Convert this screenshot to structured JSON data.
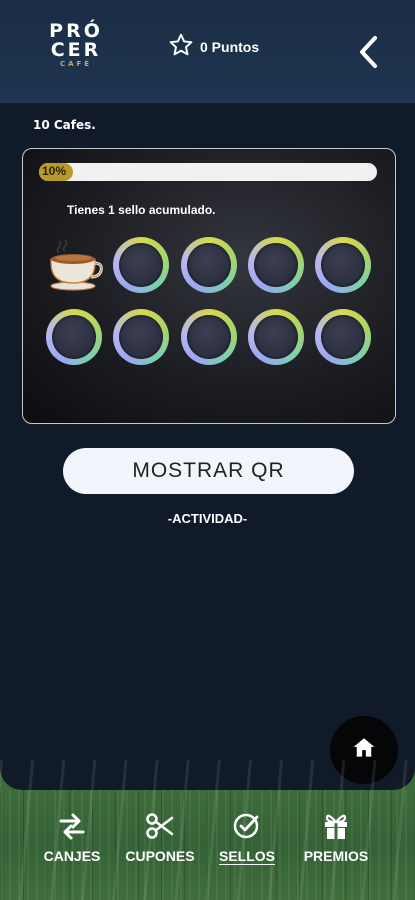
{
  "header": {
    "logo_line1": "PRÓ",
    "logo_line2": "CER",
    "logo_line3": "CAFÉ",
    "points_label": "0 Puntos",
    "icons": {
      "points": "star-outline-icon",
      "back": "chevron-left-icon"
    }
  },
  "card": {
    "count_label": "10 Cafes.",
    "progress_percent": 10,
    "progress_text": "10%",
    "message": "Tienes 1 sello acumulado.",
    "stamps_total": 10,
    "stamps_filled": 1,
    "stamp_icon": "coffee-cup-icon"
  },
  "actions": {
    "qr_label": "MOSTRAR QR",
    "activity_label": "-ACTIVIDAD-",
    "home_icon": "home-icon"
  },
  "nav": {
    "items": [
      {
        "label": "CANJES",
        "icon": "exchange-arrows-icon",
        "active": false
      },
      {
        "label": "CUPONES",
        "icon": "scissors-icon",
        "active": false
      },
      {
        "label": "SELLOS",
        "icon": "check-circle-icon",
        "active": true
      },
      {
        "label": "PREMIOS",
        "icon": "gift-icon",
        "active": false
      }
    ]
  },
  "colors": {
    "app_bg": "#111a28",
    "header_bg": "#1f3550",
    "progress_fill": "#b89a2c",
    "bottom_bg": "#3e6b3a"
  }
}
